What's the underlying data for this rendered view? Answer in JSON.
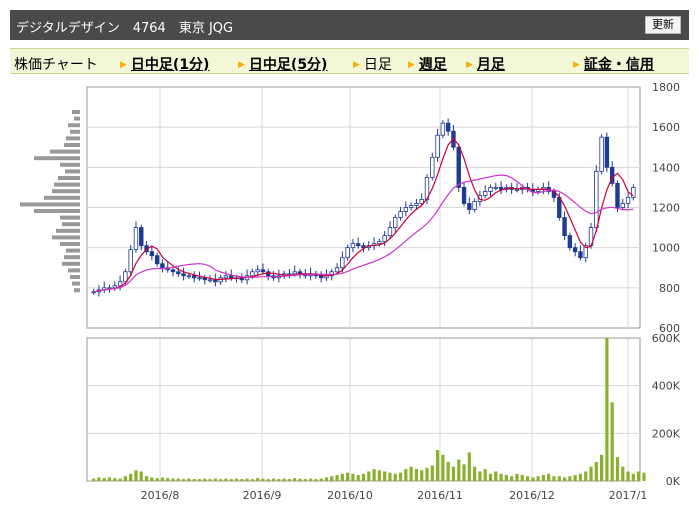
{
  "header": {
    "title": "デジタルデザイン　4764　東京 JQG",
    "refresh_label": "更新"
  },
  "nav": {
    "items": [
      {
        "label": "株価チャート",
        "link": false,
        "arrow": false
      },
      {
        "label": "日中足(1分)",
        "link": true,
        "arrow": true
      },
      {
        "label": "日中足(5分)",
        "link": true,
        "arrow": true
      },
      {
        "label": "日足",
        "link": false,
        "arrow": true
      },
      {
        "label": "週足",
        "link": true,
        "arrow": true
      },
      {
        "label": "月足",
        "link": true,
        "arrow": true
      },
      {
        "label": "証金・信用",
        "link": true,
        "arrow": true
      }
    ]
  },
  "colors": {
    "candle_down": "#1f3a93",
    "moving_average_short": "#cc0033",
    "moving_average_long": "#cc33cc",
    "volume_bar": "#8ab02e",
    "volume_profile": "#999999",
    "grid": "#d8d8d8",
    "frame": "#999999"
  },
  "chart_data": [
    {
      "type": "candlestick",
      "ylim": [
        600,
        1800
      ],
      "y_ticks": [
        "1800",
        "1600",
        "1400",
        "1200",
        "1000",
        "800",
        "600"
      ],
      "x_ticks": [
        "2016/8",
        "2016/9",
        "2016/10",
        "2016/11",
        "2016/12",
        "2017/1"
      ],
      "overlays": [
        "short moving average",
        "long moving average"
      ],
      "close_series": [
        780,
        790,
        800,
        800,
        810,
        830,
        880,
        990,
        1100,
        1010,
        980,
        960,
        920,
        900,
        890,
        880,
        870,
        860,
        860,
        850,
        850,
        840,
        840,
        830,
        850,
        860,
        850,
        850,
        840,
        860,
        880,
        890,
        880,
        860,
        850,
        860,
        870,
        870,
        880,
        870,
        860,
        870,
        860,
        850,
        860,
        880,
        900,
        950,
        1000,
        1020,
        1010,
        1000,
        1010,
        1020,
        1030,
        1060,
        1100,
        1150,
        1180,
        1200,
        1210,
        1220,
        1240,
        1350,
        1450,
        1560,
        1620,
        1580,
        1500,
        1300,
        1220,
        1190,
        1230,
        1260,
        1280,
        1300,
        1300,
        1290,
        1300,
        1290,
        1290,
        1300,
        1290,
        1280,
        1290,
        1300,
        1280,
        1250,
        1150,
        1060,
        1000,
        980,
        950,
        1010,
        1100,
        1380,
        1550,
        1400,
        1320,
        1200,
        1220,
        1250,
        1300
      ]
    },
    {
      "type": "bar",
      "title": "volume",
      "ylim": [
        0,
        600000
      ],
      "y_ticks": [
        "600K",
        "400K",
        "200K",
        "0K"
      ],
      "values": [
        10000,
        15000,
        12000,
        15000,
        12000,
        10000,
        20000,
        30000,
        45000,
        40000,
        20000,
        15000,
        12000,
        15000,
        12000,
        10000,
        10000,
        8000,
        10000,
        8000,
        8000,
        10000,
        8000,
        10000,
        8000,
        10000,
        8000,
        10000,
        8000,
        10000,
        8000,
        12000,
        10000,
        8000,
        10000,
        8000,
        10000,
        8000,
        12000,
        10000,
        8000,
        10000,
        8000,
        10000,
        15000,
        20000,
        25000,
        30000,
        35000,
        30000,
        25000,
        30000,
        40000,
        50000,
        45000,
        40000,
        35000,
        30000,
        35000,
        50000,
        60000,
        50000,
        45000,
        55000,
        65000,
        130000,
        110000,
        80000,
        60000,
        90000,
        70000,
        120000,
        60000,
        40000,
        50000,
        30000,
        40000,
        30000,
        25000,
        20000,
        30000,
        25000,
        20000,
        15000,
        20000,
        25000,
        30000,
        20000,
        20000,
        15000,
        20000,
        25000,
        30000,
        40000,
        60000,
        80000,
        110000,
        600000,
        330000,
        100000,
        60000,
        40000,
        30000,
        40000,
        35000
      ]
    }
  ]
}
